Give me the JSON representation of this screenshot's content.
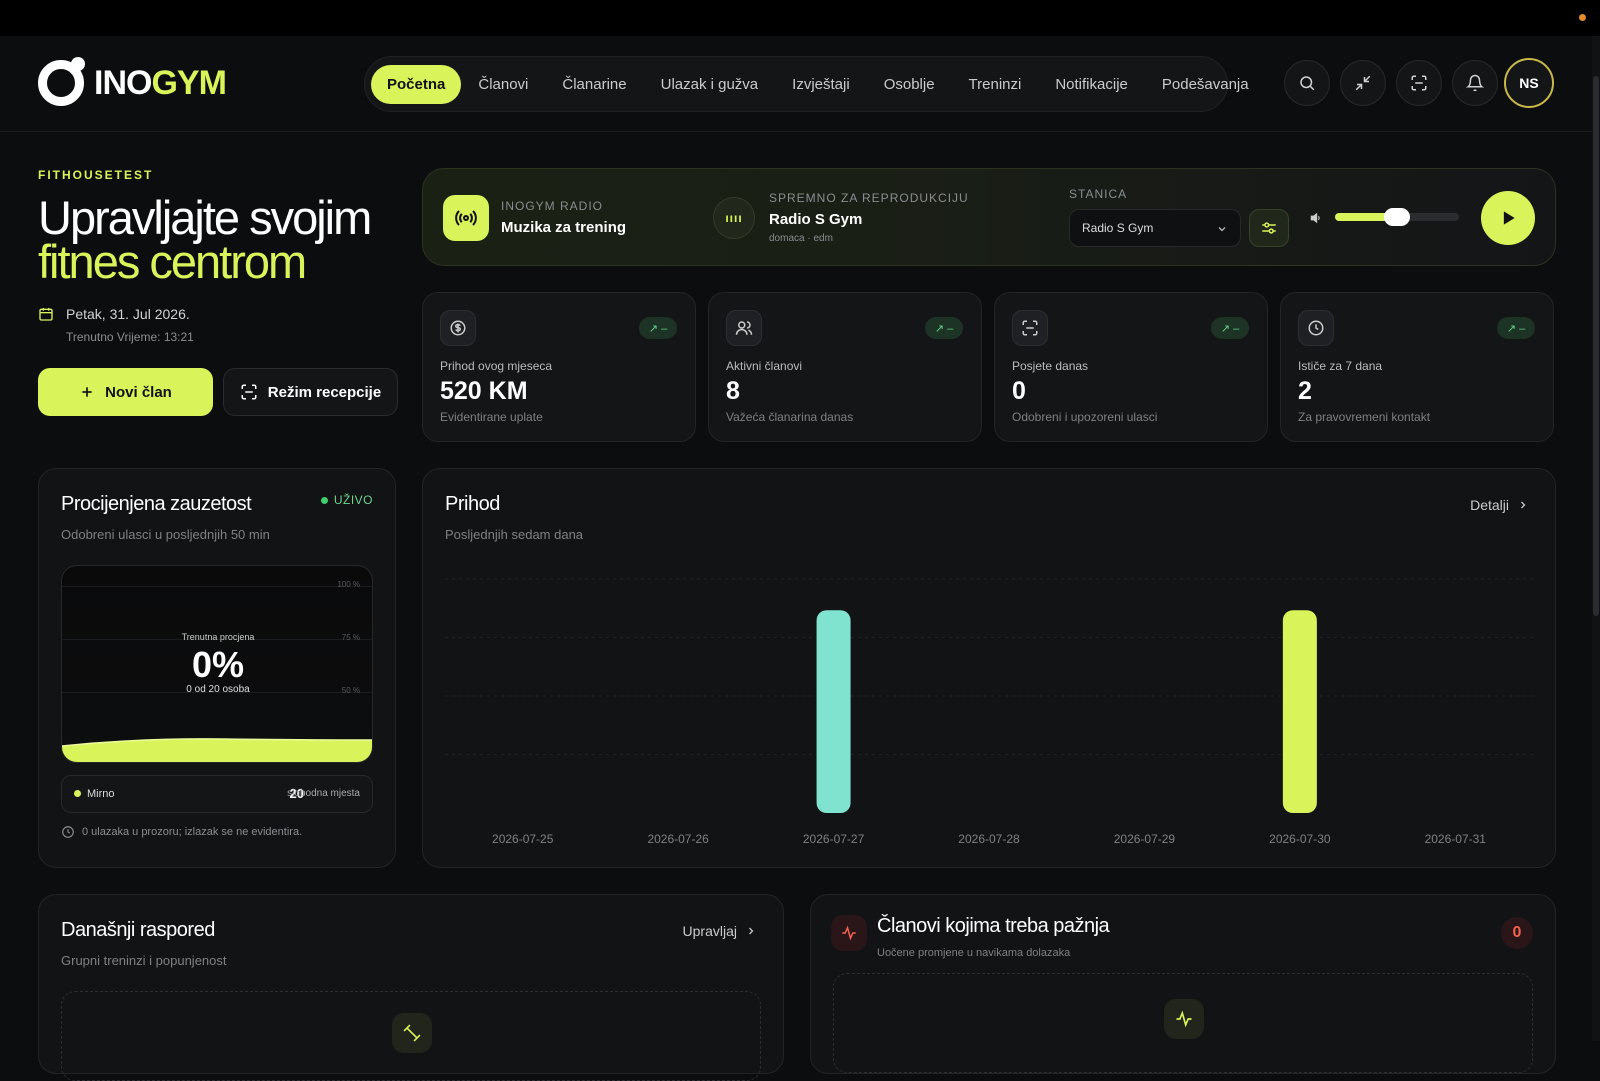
{
  "brand": {
    "part_a": "INO",
    "part_b": "GYM"
  },
  "nav": {
    "items": [
      {
        "label": "Početna",
        "active": true
      },
      {
        "label": "Članovi"
      },
      {
        "label": "Članarine"
      },
      {
        "label": "Ulazak i gužva"
      },
      {
        "label": "Izvještaji"
      },
      {
        "label": "Osoblje"
      },
      {
        "label": "Treninzi"
      },
      {
        "label": "Notifikacije"
      },
      {
        "label": "Podešavanja"
      }
    ]
  },
  "header_actions": {
    "icons": [
      "search-icon",
      "collapse-icon",
      "scan-icon",
      "bell-icon"
    ],
    "avatar_initials": "NS"
  },
  "hero": {
    "org": "FITHOUSETEST",
    "title_line1": "Upravljajte svojim",
    "title_line2": "fitnes centrom",
    "date": "Petak, 31. Jul 2026.",
    "time": "Trenutno Vrijeme: 13:21",
    "new_member_label": "Novi član",
    "reception_label": "Režim recepcije"
  },
  "radio": {
    "brand_label": "INOGYM RADIO",
    "title": "Muzika za trening",
    "status_label": "SPREMNO ZA REPRODUKCIJU",
    "station_name": "Radio S Gym",
    "station_tags": "domaca · edm",
    "station_label": "STANICA",
    "selected_station": "Radio S Gym",
    "volume": 0.5
  },
  "stats": [
    {
      "icon": "dollar-icon",
      "trend": "↗ –",
      "label": "Prihod ovog mjeseca",
      "value": "520 KM",
      "sub": "Evidentirane uplate"
    },
    {
      "icon": "users-icon",
      "trend": "↗ –",
      "label": "Aktivni članovi",
      "value": "8",
      "sub": "Važeća članarina danas"
    },
    {
      "icon": "scan-icon",
      "trend": "↗ –",
      "label": "Posjete danas",
      "value": "0",
      "sub": "Odobreni i upozoreni ulasci"
    },
    {
      "icon": "clock-icon",
      "trend": "↗ –",
      "label": "Ističe za 7 dana",
      "value": "2",
      "sub": "Za pravovremeni kontakt"
    }
  ],
  "occupancy": {
    "title": "Procijenjena zauzetost",
    "live_label": "UŽIVO",
    "subtitle": "Odobreni ulasci u posljednjih 50 min",
    "ticks": [
      "100 %",
      "75 %",
      "50 %"
    ],
    "current_label": "Trenutna procjena",
    "percent": "0%",
    "people": "0 od 20 osoba",
    "status": "Mirno",
    "free_count": "20",
    "free_label": "slobodna mjesta",
    "note": "0 ulazaka u prozoru; izlazak se ne evidentira.",
    "colors": {
      "accent": "#d9f45b",
      "live": "#3fcf6c"
    }
  },
  "revenue": {
    "title": "Prihod",
    "subtitle": "Posljednjih sedam dana",
    "details_label": "Detalji"
  },
  "chart_data": {
    "type": "bar",
    "categories": [
      "2026-07-25",
      "2026-07-26",
      "2026-07-27",
      "2026-07-28",
      "2026-07-29",
      "2026-07-30",
      "2026-07-31"
    ],
    "values": [
      0,
      0,
      260,
      0,
      0,
      260,
      0
    ],
    "colors": [
      "#d9f45b",
      "#d9f45b",
      "#7fe3cf",
      "#d9f45b",
      "#d9f45b",
      "#d9f45b",
      "#d9f45b"
    ],
    "ylim": [
      0,
      300
    ],
    "grid": true,
    "title": "Prihod",
    "xlabel": "",
    "ylabel": ""
  },
  "schedule": {
    "title": "Današnji raspored",
    "subtitle": "Grupni treninzi i popunjenost",
    "manage_label": "Upravljaj"
  },
  "attention": {
    "title": "Članovi kojima treba pažnja",
    "subtitle": "Uočene promjene u navikama dolazaka",
    "count": "0"
  }
}
